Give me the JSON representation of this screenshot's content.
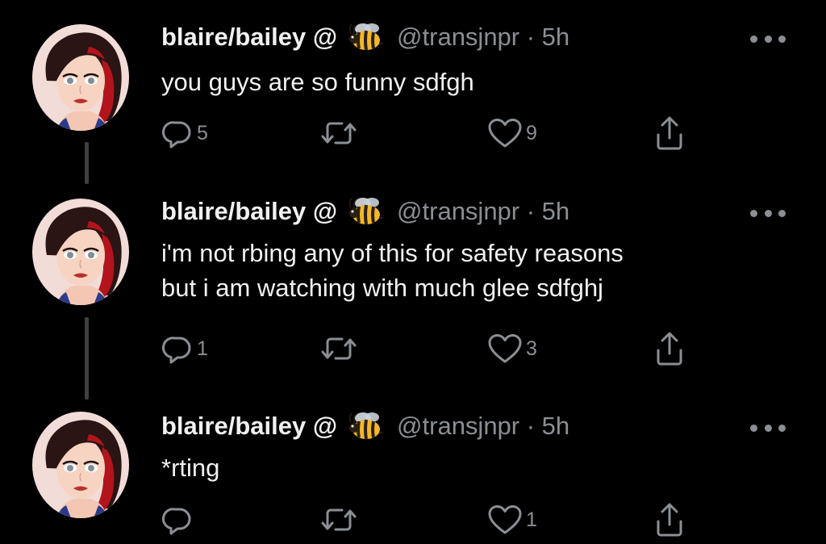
{
  "tweets": [
    {
      "display_name": "blaire/bailey @",
      "handle": "@transjnpr · 5h",
      "text": "you guys are so funny sdfgh",
      "replies": "5",
      "retweets": "",
      "likes": "9"
    },
    {
      "display_name": "blaire/bailey @",
      "handle": "@transjnpr · 5h",
      "text": "i'm not rbing any of this for safety reasons\nbut i am watching with much glee sdfghj",
      "replies": "1",
      "retweets": "",
      "likes": "3"
    },
    {
      "display_name": "blaire/bailey @",
      "handle": "@transjnpr · 5h",
      "text": "*rting",
      "replies": "",
      "retweets": "",
      "likes": "1"
    }
  ],
  "icons": {
    "reply": "reply-icon",
    "retweet": "retweet-icon",
    "like": "heart-icon",
    "share": "share-icon",
    "more": "more-options-icon",
    "emoji": "bee-emoji-icon"
  },
  "colors": {
    "background": "#000000",
    "text": "#f1f1f1",
    "secondary": "#8b8f94",
    "thread_line": "#3e4144",
    "avatar_bg": "#f2dcd8",
    "hair": "#2a1414",
    "hair_red": "#b3141c"
  }
}
